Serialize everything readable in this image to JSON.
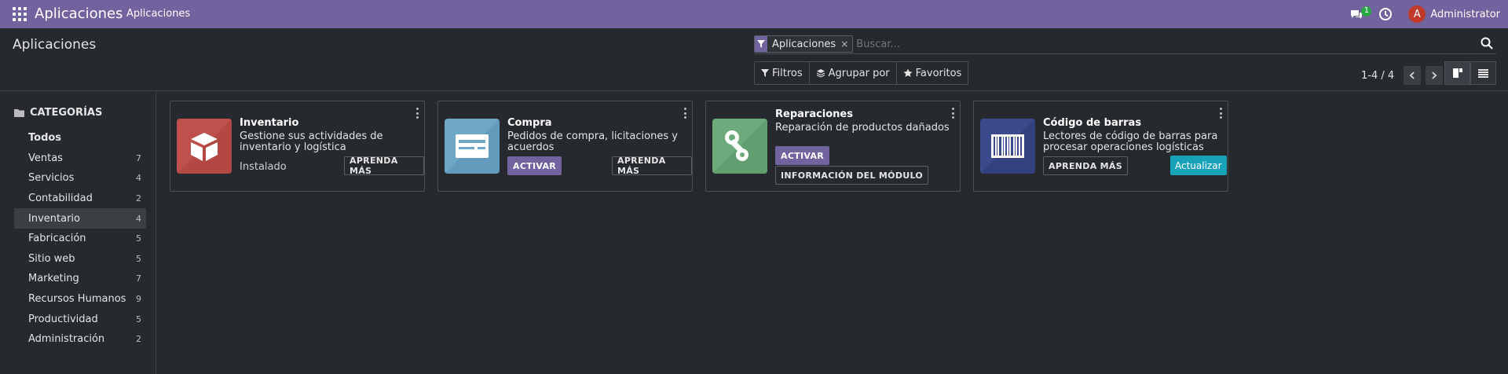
{
  "navbar": {
    "brand": "Aplicaciones",
    "menu_link": "Aplicaciones",
    "message_count": "1",
    "user_initial": "A",
    "user_name": "Administrator",
    "bg_color": "#71639e"
  },
  "control_panel": {
    "title": "Aplicaciones",
    "facet_label": "Aplicaciones",
    "facet_close": "×",
    "search_placeholder": "Buscar...",
    "filters_label": "Filtros",
    "groupby_label": "Agrupar por",
    "favorites_label": "Favoritos",
    "pager_value": "1-4 / 4"
  },
  "sidebar": {
    "header": "CATEGORÍAS",
    "items": [
      {
        "label": "Todos",
        "count": ""
      },
      {
        "label": "Ventas",
        "count": "7"
      },
      {
        "label": "Servicios",
        "count": "4"
      },
      {
        "label": "Contabilidad",
        "count": "2"
      },
      {
        "label": "Inventario",
        "count": "4"
      },
      {
        "label": "Fabricación",
        "count": "5"
      },
      {
        "label": "Sitio web",
        "count": "5"
      },
      {
        "label": "Marketing",
        "count": "7"
      },
      {
        "label": "Recursos Humanos",
        "count": "9"
      },
      {
        "label": "Productividad",
        "count": "5"
      },
      {
        "label": "Administración",
        "count": "2"
      }
    ],
    "active_item": "Inventario"
  },
  "cards": [
    {
      "title": "Inventario",
      "description": "Gestione sus actividades de inventario y logística",
      "status": "Instalado",
      "learn_more": "APRENDA MÁS",
      "icon": "box-icon",
      "icon_color": "#c0504d"
    },
    {
      "title": "Compra",
      "description": "Pedidos de compra, licitaciones y acuerdos",
      "activate": "ACTIVAR",
      "learn_more": "APRENDA MÁS",
      "icon": "purchase-card-icon",
      "icon_color": "#6fa8c7"
    },
    {
      "title": "Reparaciones",
      "description": "Reparación de productos dañados",
      "activate": "ACTIVAR",
      "module_info": "INFORMACIÓN DEL MÓDULO",
      "icon": "wrench-gear-icon",
      "icon_color": "#6daa7c"
    },
    {
      "title": "Código de barras",
      "description": "Lectores de código de barras para procesar operaciones logísticas",
      "learn_more": "APRENDA MÁS",
      "update": "Actualizar",
      "icon": "barcode-icon",
      "icon_color": "#3a4a8c"
    }
  ]
}
